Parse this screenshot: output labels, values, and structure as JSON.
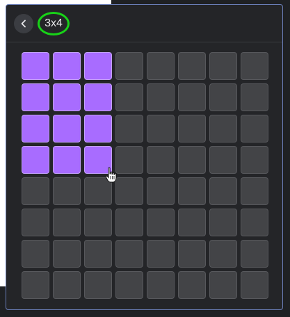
{
  "picker": {
    "selection_label": "3x4",
    "rows": 8,
    "cols": 8,
    "selected_cols": 3,
    "selected_rows": 4
  },
  "icons": {
    "back": "chevron-left-icon",
    "pointer": "hand-pointer-cursor-icon"
  },
  "colors": {
    "selected": "#a86cff",
    "cell": "#434447",
    "highlight_ring": "#18d318"
  }
}
